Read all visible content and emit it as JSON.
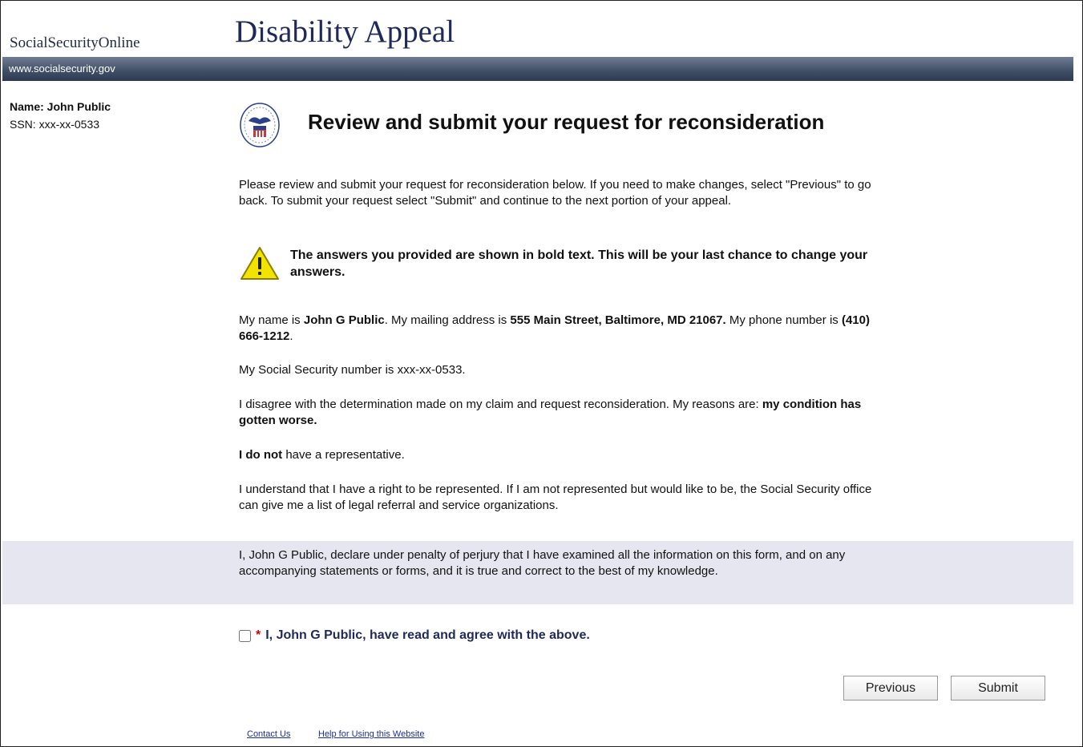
{
  "header": {
    "brand": "SocialSecurityOnline",
    "app_title": "Disability Appeal",
    "url": "www.socialsecurity.gov"
  },
  "user": {
    "name_line": "Name: John Public",
    "ssn_line": "SSN: xxx-xx-0533"
  },
  "main": {
    "page_title": "Review and submit your request for reconsideration",
    "intro": "Please review and submit your request for reconsideration below. If you need to make changes, select \"Previous\" to go back. To submit your request select \"Submit\" and continue to the next portion of your appeal.",
    "warning": "The answers you provided are shown in bold text. This will be your last chance to change your answers.",
    "contact": {
      "prefix": "My name is ",
      "name": "John G Public",
      "mid": ". My mailing address is ",
      "address": "555 Main Street, Baltimore, MD 21067.",
      "phone_prefix": " My phone number is ",
      "phone": "(410) 666-1212",
      "suffix": "."
    },
    "ssn_statement": "My Social Security number is xxx-xx-0533.",
    "disagree": {
      "prefix": "I disagree with the determination made on my claim and request reconsideration. My reasons are: ",
      "reason": "my condition has gotten worse."
    },
    "representative": {
      "status": "I do not",
      "suffix": " have a representative."
    },
    "rights_text": "I understand that I have a right to be represented. If I am not represented but would like to be, the Social Security office can give me a list of legal referral and service organizations."
  },
  "declaration": {
    "text": "I, John G Public, declare under penalty of perjury that I have examined all the information on this form, and on any accompanying statements or forms, and it is true and correct to the best of my knowledge."
  },
  "agree": {
    "required_mark": "*",
    "label": "I, John G Public, have read and agree with the above.",
    "checked": false
  },
  "buttons": {
    "previous": "Previous",
    "submit": "Submit"
  },
  "footer": {
    "links": [
      "Contact Us",
      "Help for Using this Website"
    ]
  },
  "colors": {
    "band": "#3f4e66",
    "title": "#1f2a5a",
    "declaration_bg": "#e6e6f1",
    "warning_fill": "#f2e400"
  },
  "icons": {
    "seal": "ssa-seal-icon",
    "warning": "warning-icon"
  }
}
